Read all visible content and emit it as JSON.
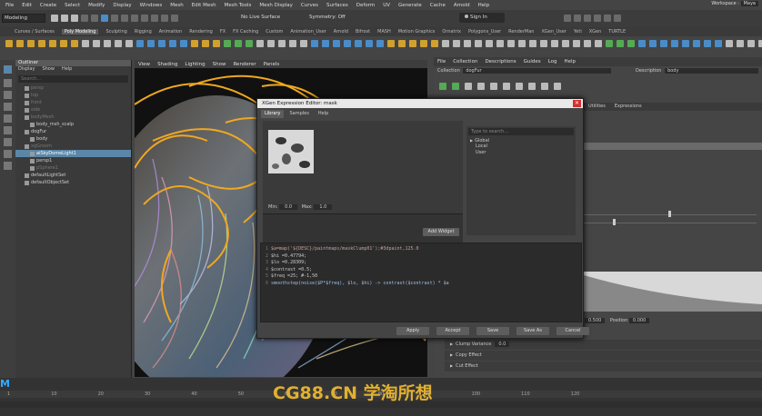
{
  "menubar": {
    "items": [
      "File",
      "Edit",
      "Create",
      "Select",
      "Modify",
      "Display",
      "Windows",
      "Mesh",
      "Edit Mesh",
      "Mesh Tools",
      "Mesh Display",
      "Curves",
      "Surfaces",
      "Deform",
      "UV",
      "Generate",
      "Cache",
      "Arnold",
      "Help"
    ],
    "workspace_label": "Workspace :",
    "workspace_value": "Maya"
  },
  "status_line": {
    "mode": "Modeling",
    "live_surface": "No Live Surface",
    "symmetry": "Symmetry: Off",
    "sign_in": "Sign In"
  },
  "shelf_tabs": [
    "Curves / Surfaces",
    "Poly Modeling",
    "Sculpting",
    "Rigging",
    "Animation",
    "Rendering",
    "FX",
    "FX Caching",
    "Custom",
    "Animation_User",
    "Arnold",
    "Bifrost",
    "MASH",
    "Motion Graphics",
    "Ornatrix",
    "Polygons_User",
    "RenderMan",
    "XGen_User",
    "Yeti",
    "XGen",
    "TURTLE"
  ],
  "outliner": {
    "title": "Outliner",
    "menu": [
      "Display",
      "Show",
      "Help"
    ],
    "search_placeholder": "Search...",
    "items": [
      {
        "label": "persp",
        "state": "dim",
        "indent": 1
      },
      {
        "label": "top",
        "state": "dim",
        "indent": 1
      },
      {
        "label": "front",
        "state": "dim",
        "indent": 1
      },
      {
        "label": "side",
        "state": "dim",
        "indent": 1
      },
      {
        "label": "bodyMesh",
        "state": "dim",
        "indent": 1
      },
      {
        "label": "body_msh_scalp",
        "state": "normal",
        "indent": 2
      },
      {
        "label": "dogFur",
        "state": "normal",
        "indent": 1
      },
      {
        "label": "body",
        "state": "normal",
        "indent": 2
      },
      {
        "label": "xgGroom",
        "state": "dim",
        "indent": 1
      },
      {
        "label": "aiSkyDomeLight1",
        "state": "sel",
        "indent": 2
      },
      {
        "label": "persp1",
        "state": "normal",
        "indent": 2
      },
      {
        "label": "pSphere1",
        "state": "dim",
        "indent": 2
      },
      {
        "label": "defaultLightSet",
        "state": "normal",
        "indent": 1
      },
      {
        "label": "defaultObjectSet",
        "state": "normal",
        "indent": 1
      }
    ]
  },
  "viewport_menu": [
    "View",
    "Shading",
    "Lighting",
    "Show",
    "Renderer",
    "Panels"
  ],
  "xgen_panel": {
    "menu": [
      "File",
      "Collection",
      "Descriptions",
      "Guides",
      "Log",
      "Help"
    ],
    "collection_label": "Collection",
    "collection_value": "dogFur",
    "description_label": "Description",
    "description_value": "body",
    "tabs": [
      "Utilities",
      "Expressions"
    ],
    "fields": {
      "field1_value": "0.500",
      "position_label": "Position",
      "position_value": "0.000"
    },
    "sections": [
      {
        "label": "Clump Variance",
        "value": "0.0"
      },
      {
        "label": "Copy Effect"
      },
      {
        "label": "Cut Effect"
      }
    ]
  },
  "dialog": {
    "title": "XGen Expression Editor: mask",
    "close_glyph": "✕",
    "tabs": [
      "Library",
      "Samples",
      "Help"
    ],
    "min_label": "Min:",
    "min_value": "0.0",
    "max_label": "Max:",
    "max_value": "1.0",
    "add_widget": "Add Widget",
    "search_placeholder": "Type to search...",
    "tree": [
      {
        "label": "Global",
        "expanded": true
      },
      {
        "label": "Local"
      },
      {
        "label": "User"
      }
    ],
    "code_lines": [
      {
        "num": "1",
        "text": "$a=map('${DESC}/paintmaps/maskClump01');#3dpaint,125.0"
      },
      {
        "num": "2",
        "text": "$hi =0.47794;"
      },
      {
        "num": "3",
        "text": "$lo =0.28309;"
      },
      {
        "num": "4",
        "text": "$contrast =0.5;"
      },
      {
        "num": "5",
        "text": "$freq =25; #-1,50"
      },
      {
        "num": "6",
        "text": "smoothstep(noise($P*$freq), $lo, $hi) -> contrast($contrast) * $a"
      }
    ],
    "buttons": [
      "Apply",
      "Accept",
      "Save",
      "Save As",
      "Cancel"
    ]
  },
  "timeline": {
    "ticks": [
      "1",
      "10",
      "20",
      "30",
      "40",
      "50",
      "60",
      "70",
      "80",
      "90",
      "100",
      "110",
      "120"
    ]
  },
  "watermark": "CG88.CN 学淘所想",
  "colors": {
    "accent_selection": "#5a87a8",
    "close_button": "#d43030",
    "curve_yellow": "#f0a820",
    "watermark": "#e2b030"
  }
}
